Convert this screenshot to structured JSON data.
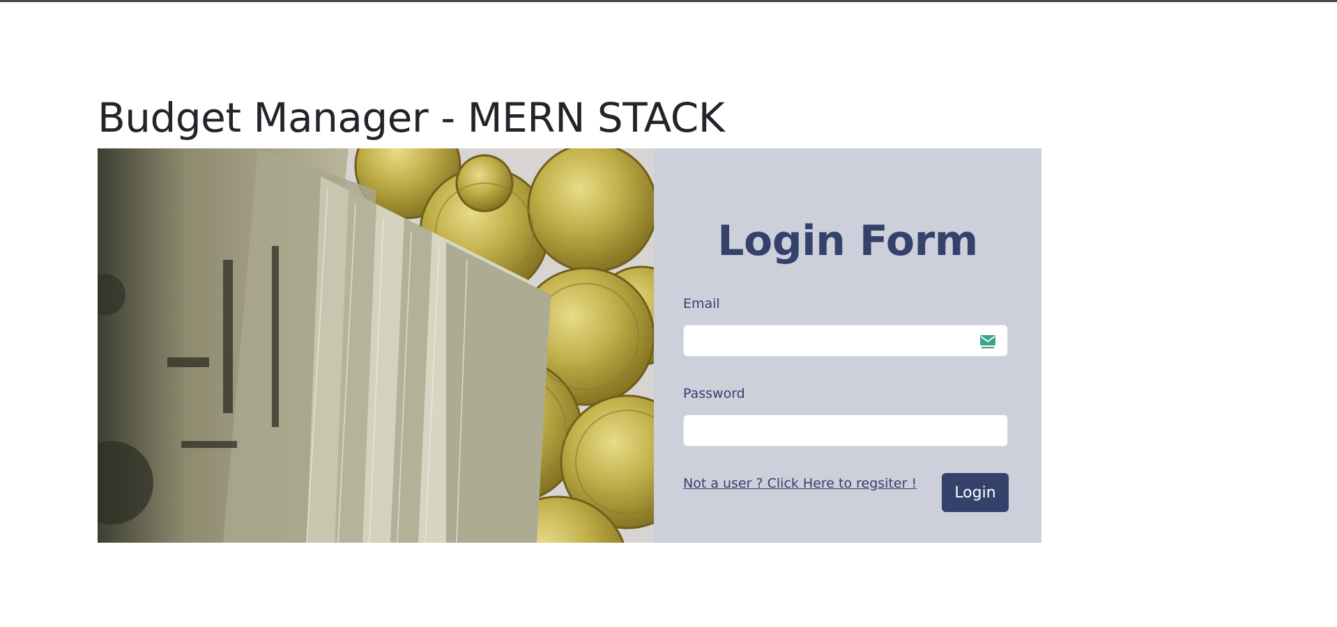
{
  "page": {
    "title": "Budget Manager - MERN STACK"
  },
  "login_form": {
    "heading": "Login Form",
    "email": {
      "label": "Email",
      "value": "",
      "placeholder": "",
      "icon": "mail-icon"
    },
    "password": {
      "label": "Password",
      "value": "",
      "placeholder": ""
    },
    "register_link": "Not a user ? Click Here to regsiter !",
    "login_button": "Login"
  },
  "colors": {
    "accent": "#34416a",
    "form_background": "#cdcfdb",
    "title_text": "#212529"
  }
}
